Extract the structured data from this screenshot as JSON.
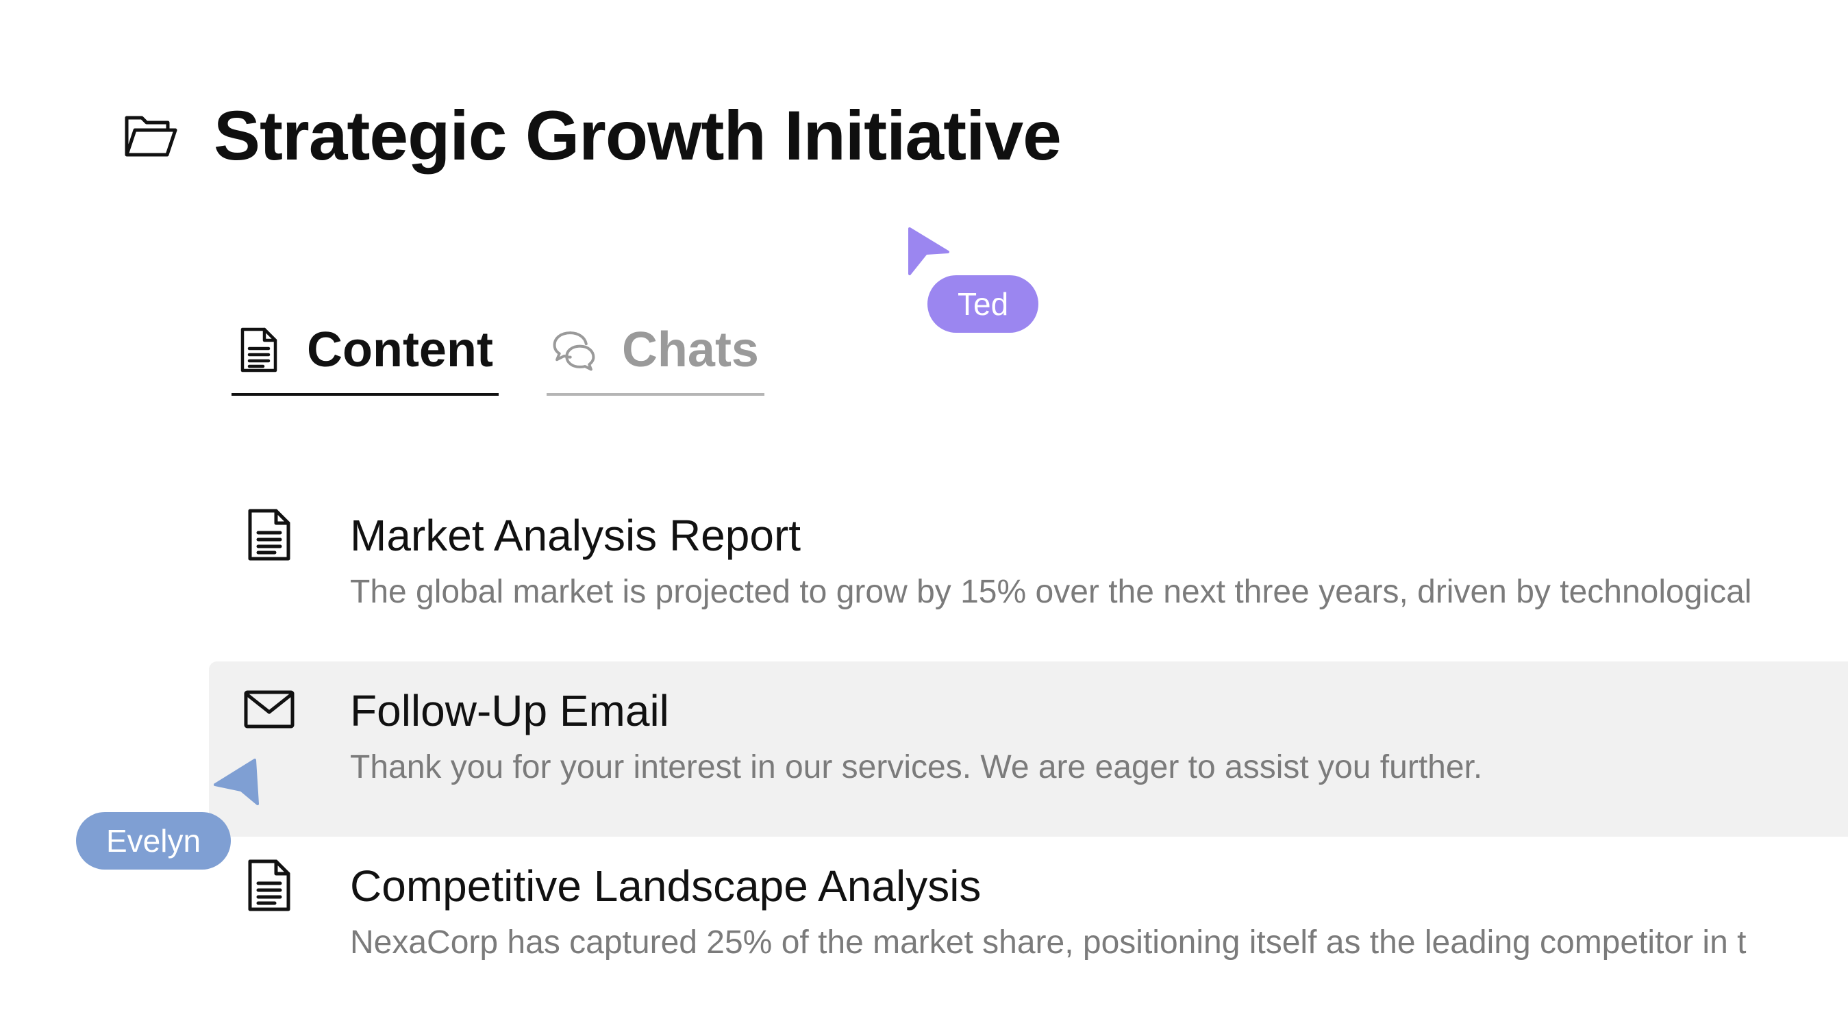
{
  "header": {
    "title": "Strategic Growth Initiative",
    "icon": "folder-open-icon"
  },
  "tabs": [
    {
      "label": "Content",
      "icon": "document-icon",
      "active": true
    },
    {
      "label": "Chats",
      "icon": "chat-bubbles-icon",
      "active": false
    }
  ],
  "items": [
    {
      "title": "Market Analysis Report",
      "description": "The global market is projected to grow by 15% over the next three years, driven by technological",
      "icon": "document-icon"
    },
    {
      "title": "Follow-Up Email",
      "description": "Thank you for your interest in our services. We are eager to assist you further.",
      "icon": "envelope-icon"
    },
    {
      "title": "Competitive Landscape Analysis",
      "description": "NexaCorp has captured 25% of the market share, positioning itself as the leading competitor in t",
      "icon": "document-icon"
    }
  ],
  "collaborators": [
    {
      "name": "Ted",
      "color": "#9b86f0"
    },
    {
      "name": "Evelyn",
      "color": "#7f9fd3"
    }
  ]
}
